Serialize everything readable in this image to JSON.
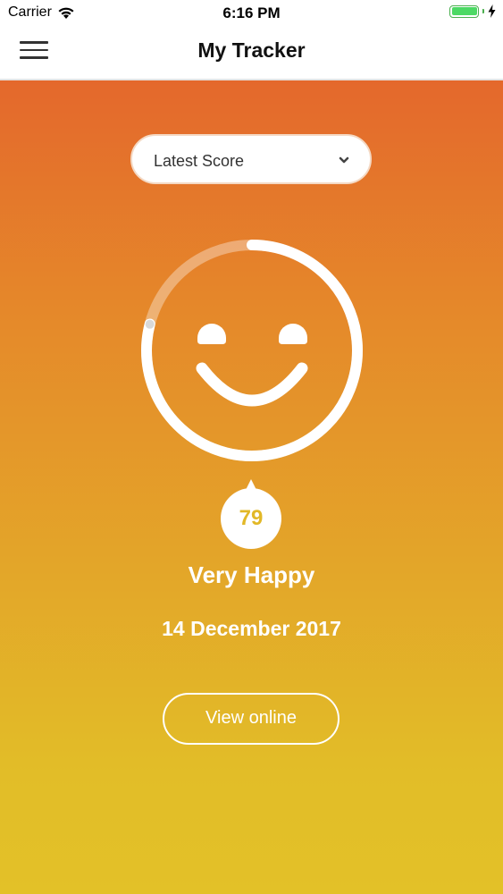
{
  "status_bar": {
    "carrier": "Carrier",
    "time": "6:16 PM",
    "battery_level": 1.0
  },
  "nav": {
    "title": "My Tracker",
    "menu_icon": "hamburger-menu-icon"
  },
  "score_select": {
    "selected": "Latest Score",
    "icon": "chevron-down-icon"
  },
  "score": {
    "value": "79",
    "progress": 0.79,
    "mood": "Very Happy",
    "date": "14 December 2017"
  },
  "actions": {
    "view_online": "View online"
  },
  "colors": {
    "gradient_top": "#e4682c",
    "gradient_bottom": "#e3c128",
    "score_text": "#e2b827",
    "battery": "#4cd964"
  }
}
